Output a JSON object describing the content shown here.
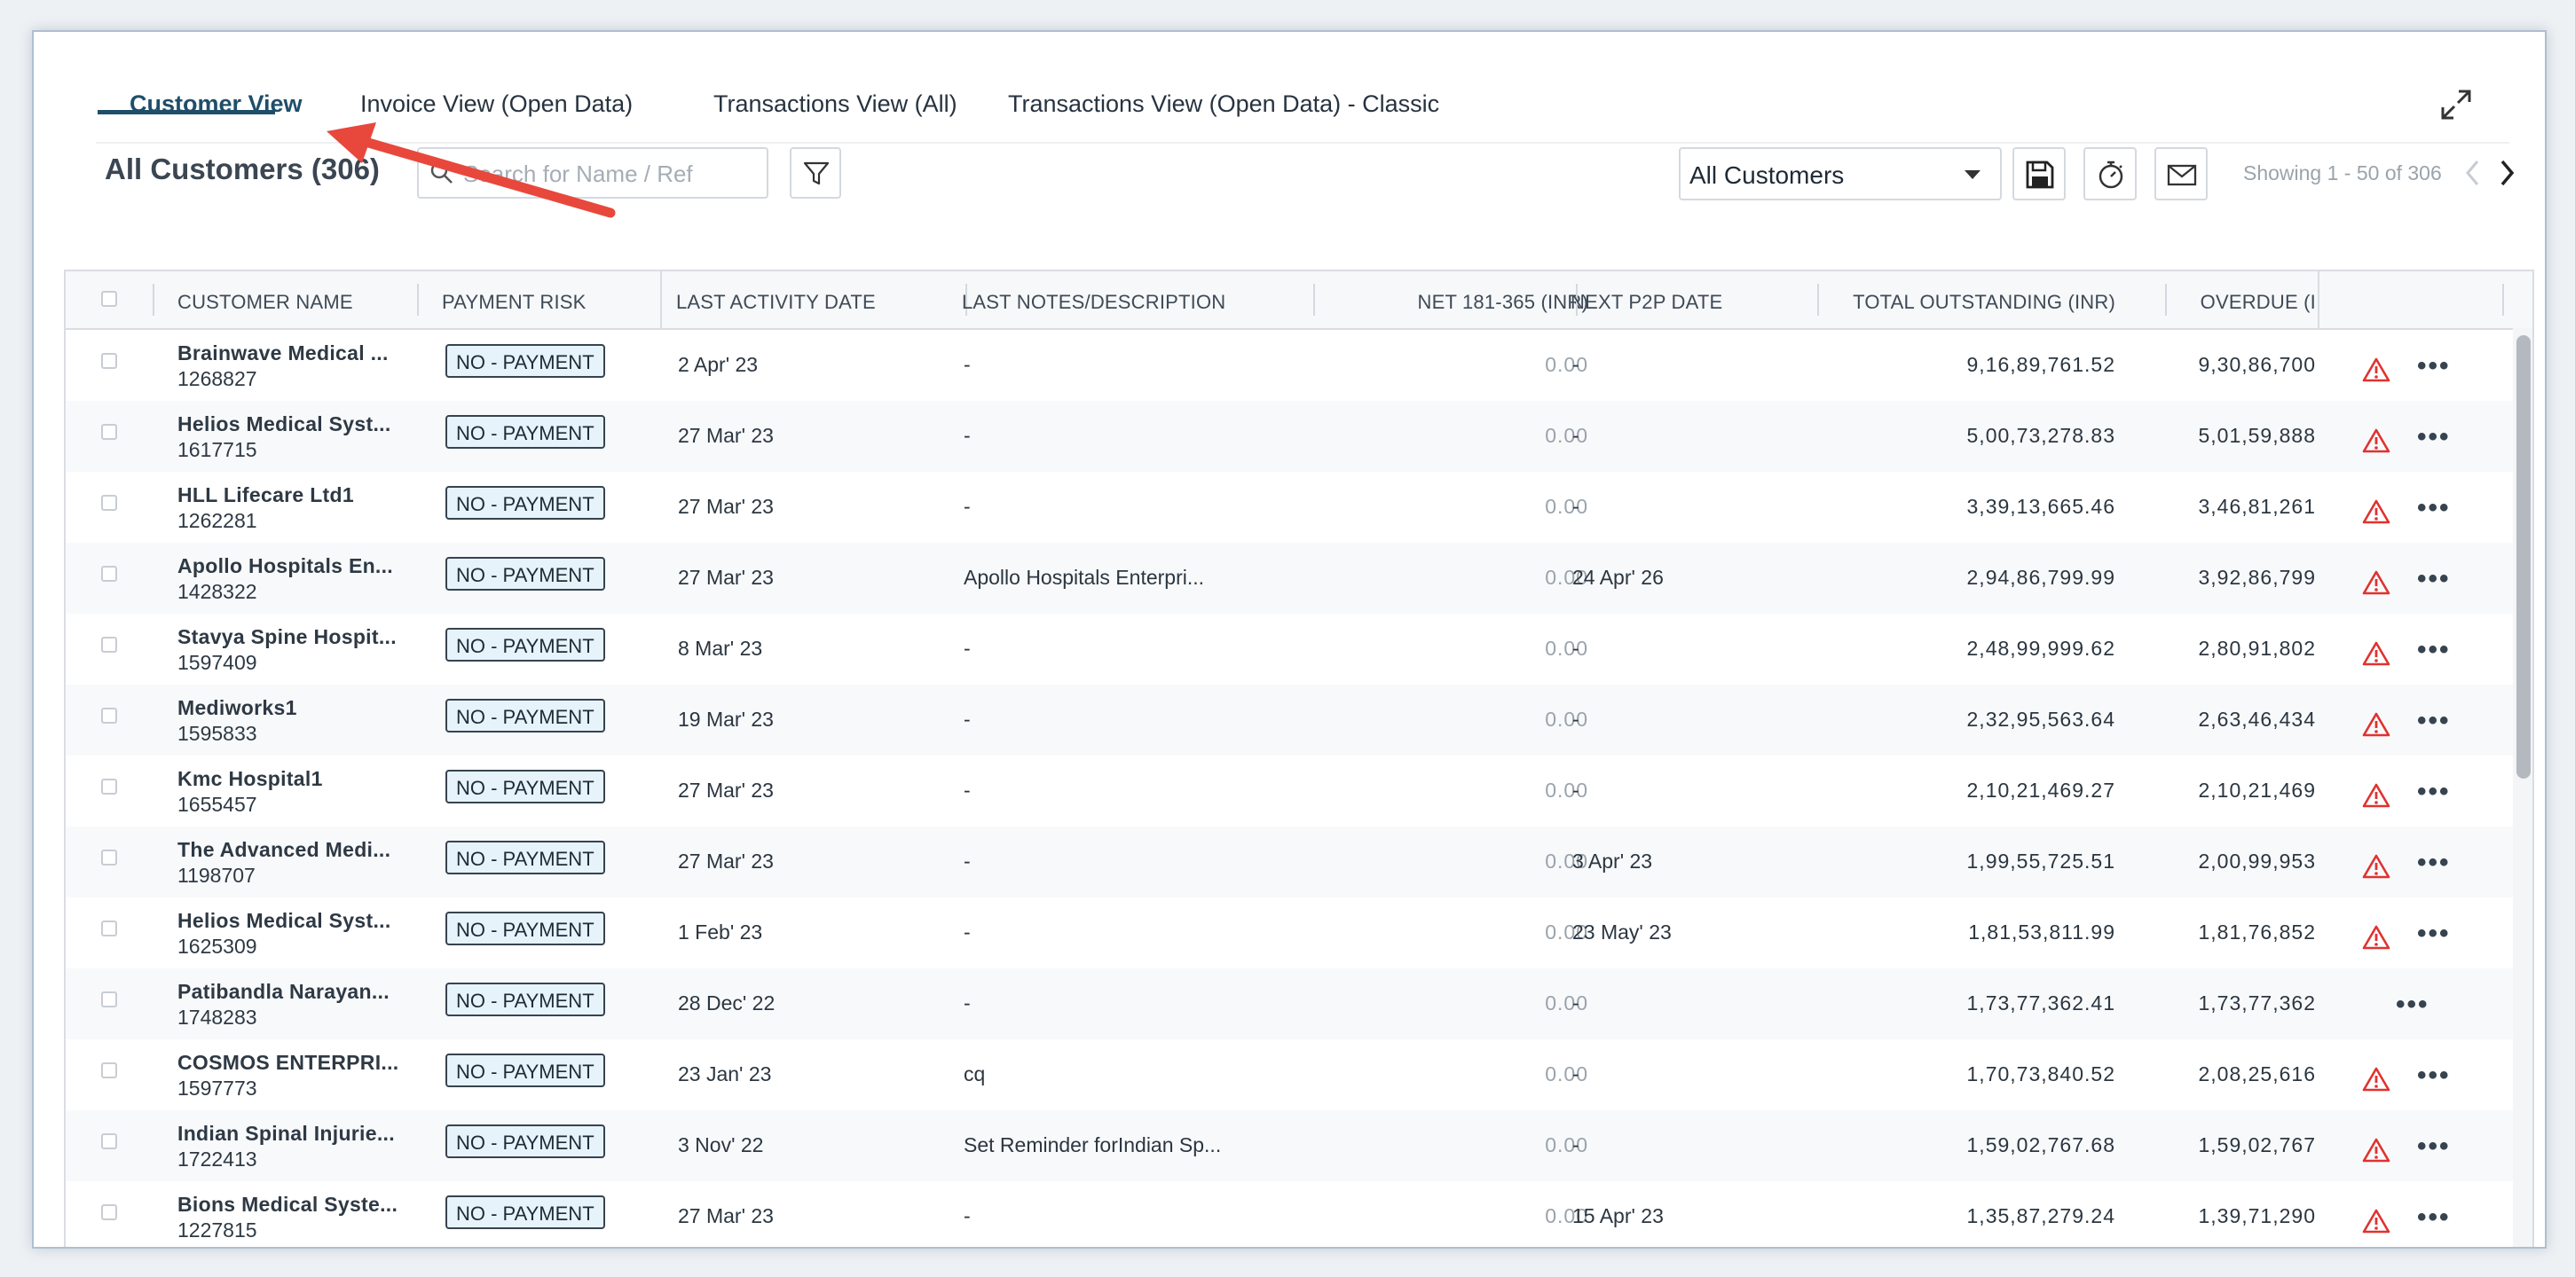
{
  "tabs": [
    {
      "label": "Customer View",
      "active": true
    },
    {
      "label": "Invoice View (Open Data)",
      "active": false
    },
    {
      "label": "Transactions View (All)",
      "active": false
    },
    {
      "label": "Transactions View (Open Data) - Classic",
      "active": false
    }
  ],
  "toolbar": {
    "title": "All Customers (306)",
    "search_placeholder": "Search for Name / Ref",
    "view_select": "All Customers",
    "pager": "Showing 1 - 50 of 306"
  },
  "table": {
    "columns": {
      "customer_name": "CUSTOMER NAME",
      "payment_risk": "PAYMENT RISK",
      "last_activity": "LAST ACTIVITY DATE",
      "last_notes": "LAST NOTES/DESCRIPTION",
      "net": "NET 181-365 (INR)",
      "p2p": "NEXT P2P DATE",
      "total": "TOTAL OUTSTANDING (INR)",
      "overdue": "OVERDUE (I"
    },
    "rows": [
      {
        "name": "Brainwave Medical ...",
        "id": "1268827",
        "risk": "NO - PAYMENT",
        "activity": "2 Apr' 23",
        "notes": "-",
        "net": "0.00",
        "p2p": "-",
        "total": "9,16,89,761.52",
        "overdue": "9,30,86,700",
        "warn": true
      },
      {
        "name": "Helios Medical Syst...",
        "id": "1617715",
        "risk": "NO - PAYMENT",
        "activity": "27 Mar' 23",
        "notes": "-",
        "net": "0.00",
        "p2p": "-",
        "total": "5,00,73,278.83",
        "overdue": "5,01,59,888",
        "warn": true
      },
      {
        "name": "HLL Lifecare Ltd1",
        "id": "1262281",
        "risk": "NO - PAYMENT",
        "activity": "27 Mar' 23",
        "notes": "-",
        "net": "0.00",
        "p2p": "-",
        "total": "3,39,13,665.46",
        "overdue": "3,46,81,261",
        "warn": true
      },
      {
        "name": "Apollo Hospitals En...",
        "id": "1428322",
        "risk": "NO - PAYMENT",
        "activity": "27 Mar' 23",
        "notes": "Apollo Hospitals Enterpri...",
        "net": "0.00",
        "p2p": "24 Apr' 26",
        "total": "2,94,86,799.99",
        "overdue": "3,92,86,799",
        "warn": true
      },
      {
        "name": "Stavya Spine Hospit...",
        "id": "1597409",
        "risk": "NO - PAYMENT",
        "activity": "8 Mar' 23",
        "notes": "-",
        "net": "0.00",
        "p2p": "-",
        "total": "2,48,99,999.62",
        "overdue": "2,80,91,802",
        "warn": true
      },
      {
        "name": "Mediworks1",
        "id": "1595833",
        "risk": "NO - PAYMENT",
        "activity": "19 Mar' 23",
        "notes": "-",
        "net": "0.00",
        "p2p": "-",
        "total": "2,32,95,563.64",
        "overdue": "2,63,46,434",
        "warn": true
      },
      {
        "name": "Kmc Hospital1",
        "id": "1655457",
        "risk": "NO - PAYMENT",
        "activity": "27 Mar' 23",
        "notes": "-",
        "net": "0.00",
        "p2p": "-",
        "total": "2,10,21,469.27",
        "overdue": "2,10,21,469",
        "warn": true
      },
      {
        "name": "The Advanced Medi...",
        "id": "1198707",
        "risk": "NO - PAYMENT",
        "activity": "27 Mar' 23",
        "notes": "-",
        "net": "0.00",
        "p2p": "3 Apr' 23",
        "total": "1,99,55,725.51",
        "overdue": "2,00,99,953",
        "warn": true
      },
      {
        "name": "Helios Medical Syst...",
        "id": "1625309",
        "risk": "NO - PAYMENT",
        "activity": "1 Feb' 23",
        "notes": "-",
        "net": "0.00",
        "p2p": "23 May' 23",
        "total": "1,81,53,811.99",
        "overdue": "1,81,76,852",
        "warn": true
      },
      {
        "name": "Patibandla Narayan...",
        "id": "1748283",
        "risk": "NO - PAYMENT",
        "activity": "28 Dec' 22",
        "notes": "-",
        "net": "0.00",
        "p2p": "-",
        "total": "1,73,77,362.41",
        "overdue": "1,73,77,362",
        "warn": false
      },
      {
        "name": "COSMOS ENTERPRI...",
        "id": "1597773",
        "risk": "NO - PAYMENT",
        "activity": "23 Jan' 23",
        "notes": "cq",
        "net": "0.00",
        "p2p": "-",
        "total": "1,70,73,840.52",
        "overdue": "2,08,25,616",
        "warn": true
      },
      {
        "name": "Indian Spinal Injurie...",
        "id": "1722413",
        "risk": "NO - PAYMENT",
        "activity": "3 Nov' 22",
        "notes": "Set Reminder forIndian Sp...",
        "net": "0.00",
        "p2p": "-",
        "total": "1,59,02,767.68",
        "overdue": "1,59,02,767",
        "warn": true
      },
      {
        "name": "Bions Medical Syste...",
        "id": "1227815",
        "risk": "NO - PAYMENT",
        "activity": "27 Mar' 23",
        "notes": "-",
        "net": "0.00",
        "p2p": "15 Apr' 23",
        "total": "1,35,87,279.24",
        "overdue": "1,39,71,290",
        "warn": true
      }
    ]
  },
  "colors": {
    "accent": "#1f4e6b",
    "badge_bg": "#e6f3fb",
    "warn": "#e0322f",
    "annotation_arrow": "#e8483c"
  }
}
